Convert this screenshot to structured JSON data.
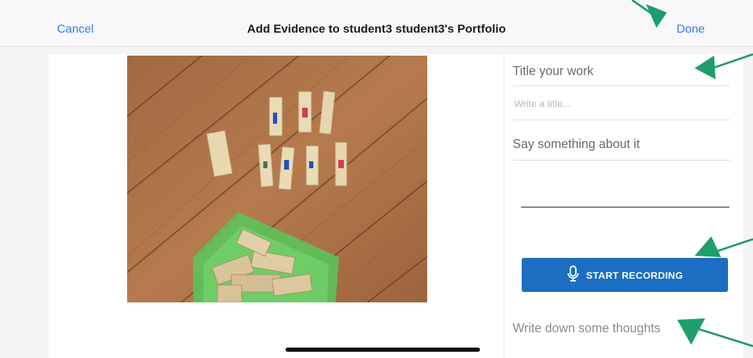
{
  "nav": {
    "cancel_label": "Cancel",
    "title": "Add Evidence to student3 student3's Portfolio",
    "done_label": "Done"
  },
  "form": {
    "title_label": "Title your work",
    "title_placeholder": "Write a title...",
    "description_label": "Say something about it",
    "record_button_label": "START RECORDING",
    "thoughts_label": "Write down some thoughts"
  },
  "colors": {
    "accent": "#3478f6",
    "record_button": "#1b6ec2",
    "annotation_arrow": "#1e9e6a"
  },
  "icons": {
    "microphone": "microphone-icon"
  }
}
